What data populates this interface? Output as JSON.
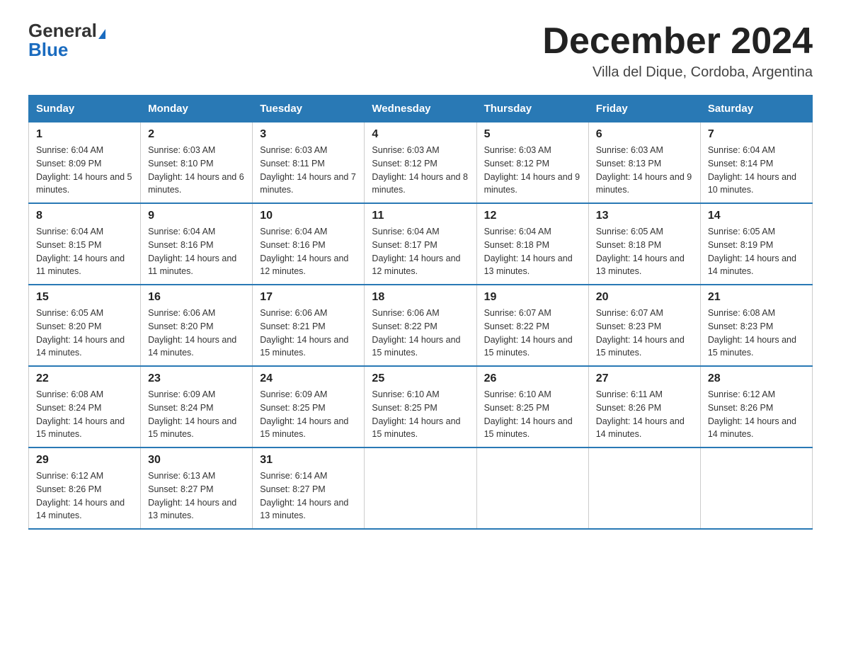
{
  "header": {
    "logo_general": "General",
    "logo_blue": "Blue",
    "month_title": "December 2024",
    "location": "Villa del Dique, Cordoba, Argentina"
  },
  "days_of_week": [
    "Sunday",
    "Monday",
    "Tuesday",
    "Wednesday",
    "Thursday",
    "Friday",
    "Saturday"
  ],
  "weeks": [
    [
      {
        "day": "1",
        "sunrise": "6:04 AM",
        "sunset": "8:09 PM",
        "daylight": "14 hours and 5 minutes."
      },
      {
        "day": "2",
        "sunrise": "6:03 AM",
        "sunset": "8:10 PM",
        "daylight": "14 hours and 6 minutes."
      },
      {
        "day": "3",
        "sunrise": "6:03 AM",
        "sunset": "8:11 PM",
        "daylight": "14 hours and 7 minutes."
      },
      {
        "day": "4",
        "sunrise": "6:03 AM",
        "sunset": "8:12 PM",
        "daylight": "14 hours and 8 minutes."
      },
      {
        "day": "5",
        "sunrise": "6:03 AM",
        "sunset": "8:12 PM",
        "daylight": "14 hours and 9 minutes."
      },
      {
        "day": "6",
        "sunrise": "6:03 AM",
        "sunset": "8:13 PM",
        "daylight": "14 hours and 9 minutes."
      },
      {
        "day": "7",
        "sunrise": "6:04 AM",
        "sunset": "8:14 PM",
        "daylight": "14 hours and 10 minutes."
      }
    ],
    [
      {
        "day": "8",
        "sunrise": "6:04 AM",
        "sunset": "8:15 PM",
        "daylight": "14 hours and 11 minutes."
      },
      {
        "day": "9",
        "sunrise": "6:04 AM",
        "sunset": "8:16 PM",
        "daylight": "14 hours and 11 minutes."
      },
      {
        "day": "10",
        "sunrise": "6:04 AM",
        "sunset": "8:16 PM",
        "daylight": "14 hours and 12 minutes."
      },
      {
        "day": "11",
        "sunrise": "6:04 AM",
        "sunset": "8:17 PM",
        "daylight": "14 hours and 12 minutes."
      },
      {
        "day": "12",
        "sunrise": "6:04 AM",
        "sunset": "8:18 PM",
        "daylight": "14 hours and 13 minutes."
      },
      {
        "day": "13",
        "sunrise": "6:05 AM",
        "sunset": "8:18 PM",
        "daylight": "14 hours and 13 minutes."
      },
      {
        "day": "14",
        "sunrise": "6:05 AM",
        "sunset": "8:19 PM",
        "daylight": "14 hours and 14 minutes."
      }
    ],
    [
      {
        "day": "15",
        "sunrise": "6:05 AM",
        "sunset": "8:20 PM",
        "daylight": "14 hours and 14 minutes."
      },
      {
        "day": "16",
        "sunrise": "6:06 AM",
        "sunset": "8:20 PM",
        "daylight": "14 hours and 14 minutes."
      },
      {
        "day": "17",
        "sunrise": "6:06 AM",
        "sunset": "8:21 PM",
        "daylight": "14 hours and 15 minutes."
      },
      {
        "day": "18",
        "sunrise": "6:06 AM",
        "sunset": "8:22 PM",
        "daylight": "14 hours and 15 minutes."
      },
      {
        "day": "19",
        "sunrise": "6:07 AM",
        "sunset": "8:22 PM",
        "daylight": "14 hours and 15 minutes."
      },
      {
        "day": "20",
        "sunrise": "6:07 AM",
        "sunset": "8:23 PM",
        "daylight": "14 hours and 15 minutes."
      },
      {
        "day": "21",
        "sunrise": "6:08 AM",
        "sunset": "8:23 PM",
        "daylight": "14 hours and 15 minutes."
      }
    ],
    [
      {
        "day": "22",
        "sunrise": "6:08 AM",
        "sunset": "8:24 PM",
        "daylight": "14 hours and 15 minutes."
      },
      {
        "day": "23",
        "sunrise": "6:09 AM",
        "sunset": "8:24 PM",
        "daylight": "14 hours and 15 minutes."
      },
      {
        "day": "24",
        "sunrise": "6:09 AM",
        "sunset": "8:25 PM",
        "daylight": "14 hours and 15 minutes."
      },
      {
        "day": "25",
        "sunrise": "6:10 AM",
        "sunset": "8:25 PM",
        "daylight": "14 hours and 15 minutes."
      },
      {
        "day": "26",
        "sunrise": "6:10 AM",
        "sunset": "8:25 PM",
        "daylight": "14 hours and 15 minutes."
      },
      {
        "day": "27",
        "sunrise": "6:11 AM",
        "sunset": "8:26 PM",
        "daylight": "14 hours and 14 minutes."
      },
      {
        "day": "28",
        "sunrise": "6:12 AM",
        "sunset": "8:26 PM",
        "daylight": "14 hours and 14 minutes."
      }
    ],
    [
      {
        "day": "29",
        "sunrise": "6:12 AM",
        "sunset": "8:26 PM",
        "daylight": "14 hours and 14 minutes."
      },
      {
        "day": "30",
        "sunrise": "6:13 AM",
        "sunset": "8:27 PM",
        "daylight": "14 hours and 13 minutes."
      },
      {
        "day": "31",
        "sunrise": "6:14 AM",
        "sunset": "8:27 PM",
        "daylight": "14 hours and 13 minutes."
      },
      null,
      null,
      null,
      null
    ]
  ]
}
